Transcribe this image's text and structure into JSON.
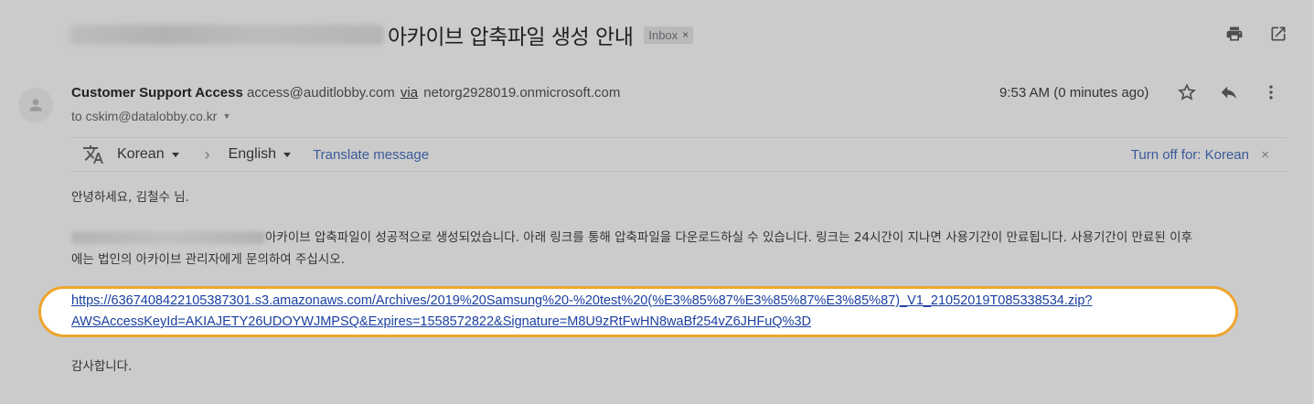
{
  "subject": {
    "title": "아카이브 압축파일 생성 안내",
    "badge_label": "Inbox",
    "badge_close": "×"
  },
  "header_icons": [
    "print-icon",
    "open-in-new-window-icon"
  ],
  "sender": {
    "name": "Customer Support Access",
    "email": "access@auditlobby.com",
    "via": "via",
    "via_domain": "netorg2928019.onmicrosoft.com",
    "to": "to cskim@datalobby.co.kr",
    "time": "9:53 AM (0 minutes ago)"
  },
  "message_actions": [
    "star-icon",
    "reply-icon",
    "more-vert-icon"
  ],
  "translate": {
    "from_language": "Korean",
    "to_language": "English",
    "translate_link": "Translate message",
    "turn_off_label": "Turn off for: Korean",
    "close": "×"
  },
  "body": {
    "greeting": "안녕하세요, 김철수 님.",
    "paragraph_line1": "아카이브 압축파일이 성공적으로 생성되었습니다. 아래 링크를 통해 압축파일을 다운로드하실 수 있습니다. 링크는 24시간이 지나면 사용기간이 만료됩니다. 사용기간이 만료된 이후",
    "paragraph_line2": "에는 법인의 아카이브 관리자에게 문의하여 주십시오.",
    "link_line1": "https://636740842210538730​1.s3.amazonaws.com/Archives/2019%20Samsung%20-%20test%20(%E3%85%87%E3%85%87%E3%85%87)_V1_21052019T085338534.zip?",
    "link_line2": "AWSAccessKeyId=AKIAJETY26UDOYWJMPSQ&Expires=1558572822&Signature=M8U9zRtFwHN8waBf254vZ6JHFuQ%3D",
    "closing": "감사합니다."
  },
  "colors": {
    "background": "#cbcbcb",
    "link": "#1a3fa0",
    "highlight_border": "#eea52d",
    "translate_link": "#3a5a9a"
  }
}
